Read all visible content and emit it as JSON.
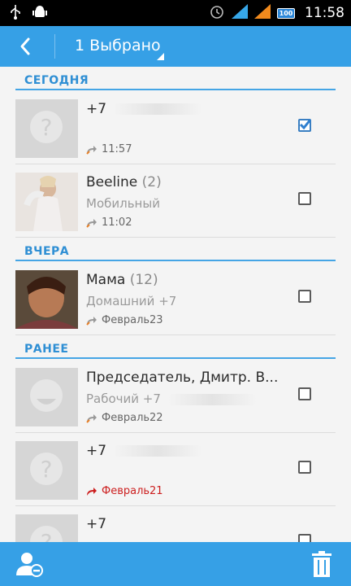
{
  "status_bar": {
    "time": "11:58",
    "battery": "100"
  },
  "action_bar": {
    "title": "1 Выбрано"
  },
  "sections": [
    {
      "label": "СЕГОДНЯ",
      "rows": [
        {
          "name": "+7",
          "count": "",
          "sub": "",
          "time": "11:57",
          "call_type": "outgoing",
          "checked": true,
          "avatar": "placeholder-question"
        }
      ]
    }
  ],
  "today": {
    "label": "СЕГОДНЯ",
    "row1": {
      "name": "+7",
      "time": "11:57"
    },
    "row2": {
      "name": "Beeline",
      "count": "(2)",
      "sub": "Мобильный",
      "time": "11:02"
    }
  },
  "yesterday": {
    "label": "ВЧЕРА",
    "row1": {
      "name": "Мама",
      "count": "(12)",
      "sub": "Домашний +7",
      "time": "Февраль23"
    }
  },
  "earlier": {
    "label": "РАНЕЕ",
    "row1": {
      "name": "Председатель, Дмитр. В...",
      "sub": "Рабочий +7",
      "time": "Февраль22"
    },
    "row2": {
      "name": "+7",
      "time": "Февраль21"
    },
    "row3": {
      "name": "+7"
    }
  },
  "colors": {
    "accent": "#36a0e6",
    "section": "#2f8fd4",
    "missed": "#cc1f1f",
    "call_arrow": "#e8822a"
  },
  "icons": {
    "back": "chevron-left-icon",
    "contact_remove": "person-minus-icon",
    "delete": "trash-icon",
    "outgoing": "outgoing-call-icon",
    "missed": "missed-call-icon"
  }
}
